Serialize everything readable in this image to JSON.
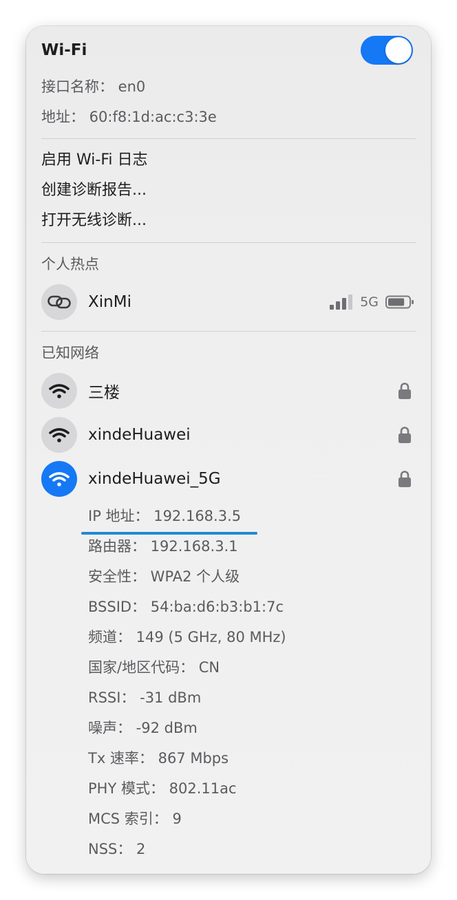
{
  "wifi": {
    "title": "Wi-Fi",
    "enabled": true,
    "interface_line": "接口名称： en0",
    "address_line": "地址： 60:f8:1d:ac:c3:3e"
  },
  "menu": {
    "items": [
      "启用 Wi-Fi 日志",
      "创建诊断报告...",
      "打开无线诊断..."
    ]
  },
  "hotspot": {
    "section_title": "个人热点",
    "name": "XinMi",
    "band": "5G",
    "signal_bars": 3,
    "battery_level": 0.8
  },
  "known": {
    "section_title": "已知网络",
    "networks": [
      {
        "name": "三楼",
        "locked": true,
        "connected": false
      },
      {
        "name": "xindeHuawei",
        "locked": true,
        "connected": false
      },
      {
        "name": "xindeHuawei_5G",
        "locked": true,
        "connected": true
      }
    ],
    "details": [
      "IP 地址： 192.168.3.5",
      "路由器： 192.168.3.1",
      "安全性： WPA2 个人级",
      "BSSID： 54:ba:d6:b3:b1:7c",
      "频道： 149 (5 GHz, 80 MHz)",
      "国家/地区代码： CN",
      "RSSI： -31 dBm",
      "噪声： -92 dBm",
      "Tx 速率： 867 Mbps",
      "PHY 模式： 802.11ac",
      "MCS 索引： 9",
      "NSS： 2"
    ]
  },
  "colors": {
    "accent": "#1578f5",
    "highlight": "#1f8ad2"
  }
}
